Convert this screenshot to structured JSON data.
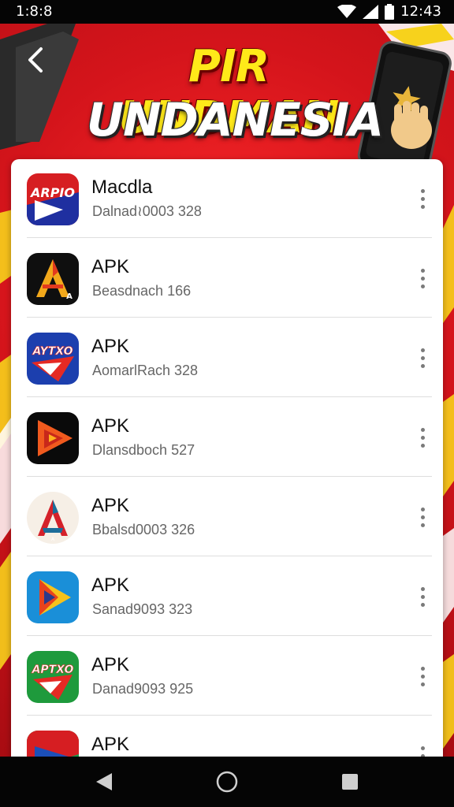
{
  "status_bar": {
    "time": "1:8:8",
    "clock_right": "12:43",
    "icons": [
      "wifi-icon",
      "signal-icon",
      "battery-icon"
    ]
  },
  "header": {
    "title_line1": "PIR UNDMAN",
    "title_line2": "UNDANESIA",
    "back_icon": "back-arrow-icon"
  },
  "apps": [
    {
      "name": "Macdla",
      "subtitle": "Dalnad≀0003 328",
      "icon_text": "ARPIO"
    },
    {
      "name": "APK",
      "subtitle": "Beasdnach 166",
      "icon_text": "A"
    },
    {
      "name": "APK",
      "subtitle": "AomarlRach 328",
      "icon_text": "AYTXO"
    },
    {
      "name": "APK",
      "subtitle": "Dlansdboch 527",
      "icon_text": ""
    },
    {
      "name": "APK",
      "subtitle": "Bbalsd0003 326",
      "icon_text": "A"
    },
    {
      "name": "APK",
      "subtitle": "Sanad9093 323",
      "icon_text": ""
    },
    {
      "name": "APK",
      "subtitle": "Danad9093 925",
      "icon_text": "APTXO"
    },
    {
      "name": "APK",
      "subtitle": "",
      "icon_text": ""
    }
  ],
  "nav_bar": {
    "icons": [
      "back-triangle-icon",
      "home-circle-icon",
      "recents-square-icon"
    ]
  },
  "colors": {
    "brand_red": "#d4141b",
    "title_yellow": "#ffe919",
    "card_bg": "#ffffff"
  }
}
